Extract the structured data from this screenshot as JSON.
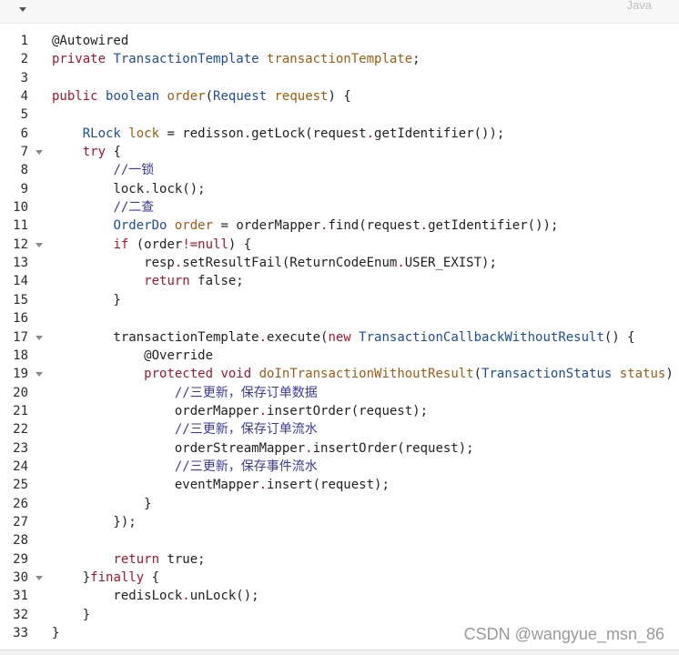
{
  "header": {
    "language": "Java",
    "collapse_icon": "chevron-down-icon"
  },
  "watermark": "CSDN @wangyue_msn_86",
  "lines": [
    {
      "n": "1",
      "fold": false,
      "tokens": [
        [
          "ann",
          "@Autowired"
        ]
      ]
    },
    {
      "n": "2",
      "fold": false,
      "tokens": [
        [
          "kw",
          "private "
        ],
        [
          "type",
          "TransactionTemplate "
        ],
        [
          "vr",
          "transactionTemplate"
        ],
        [
          "plain",
          ";"
        ]
      ]
    },
    {
      "n": "3",
      "fold": false,
      "tokens": []
    },
    {
      "n": "4",
      "fold": false,
      "tokens": [
        [
          "kw",
          "public "
        ],
        [
          "type",
          "boolean "
        ],
        [
          "vr",
          "order"
        ],
        [
          "plain",
          "("
        ],
        [
          "type",
          "Request "
        ],
        [
          "vr",
          "request"
        ],
        [
          "plain",
          ") {"
        ]
      ]
    },
    {
      "n": "5",
      "fold": false,
      "tokens": []
    },
    {
      "n": "6",
      "fold": false,
      "tokens": [
        [
          "plain",
          "    "
        ],
        [
          "type",
          "RLock "
        ],
        [
          "vr",
          "lock"
        ],
        [
          "plain",
          " = redisson"
        ],
        [
          "op",
          "."
        ],
        [
          "plain",
          "getLock(request"
        ],
        [
          "op",
          "."
        ],
        [
          "plain",
          "getIdentifier());"
        ]
      ]
    },
    {
      "n": "7",
      "fold": true,
      "tokens": [
        [
          "plain",
          "    "
        ],
        [
          "kw",
          "try"
        ],
        [
          "plain",
          " {"
        ]
      ]
    },
    {
      "n": "8",
      "fold": false,
      "tokens": [
        [
          "plain",
          "        "
        ],
        [
          "com",
          "//一锁"
        ]
      ]
    },
    {
      "n": "9",
      "fold": false,
      "tokens": [
        [
          "plain",
          "        lock"
        ],
        [
          "op",
          "."
        ],
        [
          "plain",
          "lock();"
        ]
      ]
    },
    {
      "n": "10",
      "fold": false,
      "tokens": [
        [
          "plain",
          "        "
        ],
        [
          "com",
          "//二查"
        ]
      ]
    },
    {
      "n": "11",
      "fold": false,
      "tokens": [
        [
          "plain",
          "        "
        ],
        [
          "type",
          "OrderDo "
        ],
        [
          "vr",
          "order"
        ],
        [
          "plain",
          " = orderMapper"
        ],
        [
          "op",
          "."
        ],
        [
          "plain",
          "find(request"
        ],
        [
          "op",
          "."
        ],
        [
          "plain",
          "getIdentifier());"
        ]
      ]
    },
    {
      "n": "12",
      "fold": true,
      "tokens": [
        [
          "plain",
          "        "
        ],
        [
          "kw",
          "if"
        ],
        [
          "plain",
          " (order"
        ],
        [
          "op",
          "!="
        ],
        [
          "kw",
          "null"
        ],
        [
          "plain",
          ") {"
        ]
      ]
    },
    {
      "n": "13",
      "fold": false,
      "tokens": [
        [
          "plain",
          "            resp"
        ],
        [
          "op",
          "."
        ],
        [
          "plain",
          "setResultFail(ReturnCodeEnum"
        ],
        [
          "op",
          "."
        ],
        [
          "plain",
          "USER_EXIST);"
        ]
      ]
    },
    {
      "n": "14",
      "fold": false,
      "tokens": [
        [
          "plain",
          "            "
        ],
        [
          "kw",
          "return"
        ],
        [
          "plain",
          " false;"
        ]
      ]
    },
    {
      "n": "15",
      "fold": false,
      "tokens": [
        [
          "plain",
          "        }"
        ]
      ]
    },
    {
      "n": "16",
      "fold": false,
      "tokens": []
    },
    {
      "n": "17",
      "fold": true,
      "tokens": [
        [
          "plain",
          "        transactionTemplate"
        ],
        [
          "op",
          "."
        ],
        [
          "plain",
          "execute("
        ],
        [
          "kw",
          "new "
        ],
        [
          "type",
          "TransactionCallbackWithoutResult"
        ],
        [
          "plain",
          "() {"
        ]
      ]
    },
    {
      "n": "18",
      "fold": false,
      "tokens": [
        [
          "plain",
          "            "
        ],
        [
          "ann",
          "@Override"
        ]
      ]
    },
    {
      "n": "19",
      "fold": true,
      "tokens": [
        [
          "plain",
          "            "
        ],
        [
          "kw",
          "protected "
        ],
        [
          "kw",
          "void "
        ],
        [
          "vr",
          "doInTransactionWithoutResult"
        ],
        [
          "plain",
          "("
        ],
        [
          "type",
          "TransactionStatus "
        ],
        [
          "vr",
          "status"
        ],
        [
          "plain",
          ")"
        ]
      ]
    },
    {
      "n": "20",
      "fold": false,
      "tokens": [
        [
          "plain",
          "                "
        ],
        [
          "com",
          "//三更新，保存订单数据"
        ]
      ]
    },
    {
      "n": "21",
      "fold": false,
      "tokens": [
        [
          "plain",
          "                orderMapper"
        ],
        [
          "op",
          "."
        ],
        [
          "plain",
          "insertOrder(request);"
        ]
      ]
    },
    {
      "n": "22",
      "fold": false,
      "tokens": [
        [
          "plain",
          "                "
        ],
        [
          "com",
          "//三更新，保存订单流水"
        ]
      ]
    },
    {
      "n": "23",
      "fold": false,
      "tokens": [
        [
          "plain",
          "                orderStreamMapper"
        ],
        [
          "op",
          "."
        ],
        [
          "plain",
          "insertOrder(request);"
        ]
      ]
    },
    {
      "n": "24",
      "fold": false,
      "tokens": [
        [
          "plain",
          "                "
        ],
        [
          "com",
          "//三更新，保存事件流水"
        ]
      ]
    },
    {
      "n": "25",
      "fold": false,
      "tokens": [
        [
          "plain",
          "                eventMapper"
        ],
        [
          "op",
          "."
        ],
        [
          "plain",
          "insert(request);"
        ]
      ]
    },
    {
      "n": "26",
      "fold": false,
      "tokens": [
        [
          "plain",
          "            }"
        ]
      ]
    },
    {
      "n": "27",
      "fold": false,
      "tokens": [
        [
          "plain",
          "        });"
        ]
      ]
    },
    {
      "n": "28",
      "fold": false,
      "tokens": []
    },
    {
      "n": "29",
      "fold": false,
      "tokens": [
        [
          "plain",
          "        "
        ],
        [
          "kw",
          "return"
        ],
        [
          "plain",
          " true;"
        ]
      ]
    },
    {
      "n": "30",
      "fold": true,
      "tokens": [
        [
          "plain",
          "    }"
        ],
        [
          "kw",
          "finally"
        ],
        [
          "plain",
          " {"
        ]
      ]
    },
    {
      "n": "31",
      "fold": false,
      "tokens": [
        [
          "plain",
          "        redisLock"
        ],
        [
          "op",
          "."
        ],
        [
          "plain",
          "unLock();"
        ]
      ]
    },
    {
      "n": "32",
      "fold": false,
      "tokens": [
        [
          "plain",
          "    }"
        ]
      ]
    },
    {
      "n": "33",
      "fold": false,
      "tokens": [
        [
          "plain",
          "}"
        ]
      ]
    }
  ]
}
